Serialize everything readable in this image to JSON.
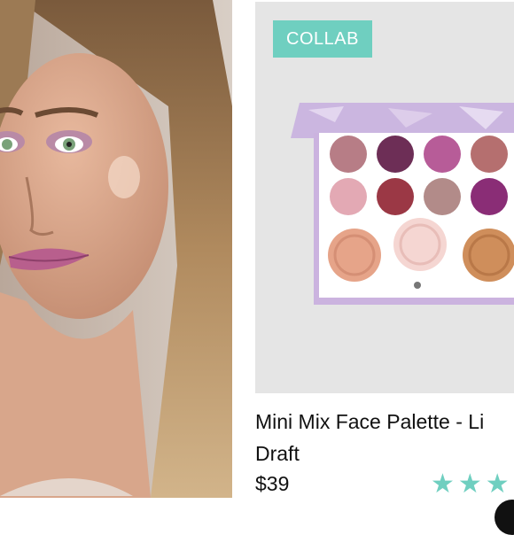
{
  "listing": {
    "badge": "COLLAB",
    "title_line1": "Mini Mix Face Palette - Li",
    "title_line2": "Draft",
    "price": "$39",
    "rating_stars": "★★★",
    "accent_color": "#6fcfc0"
  },
  "icons": {
    "rating": "star-icon",
    "chat": "chat-bubble-icon"
  }
}
